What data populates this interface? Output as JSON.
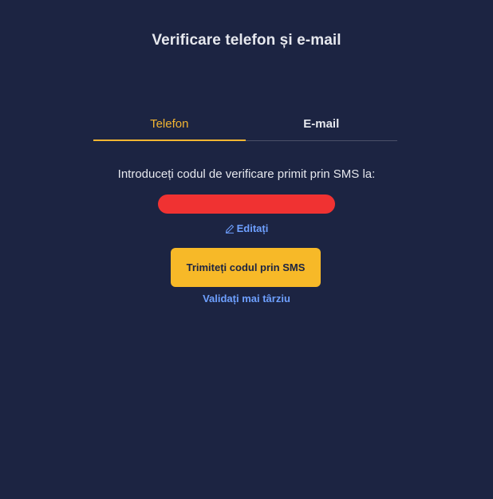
{
  "header": {
    "title": "Verificare telefon și e-mail"
  },
  "tabs": [
    {
      "label": "Telefon",
      "active": true
    },
    {
      "label": "E-mail",
      "active": false
    }
  ],
  "main": {
    "instruction": "Introduceți codul de verificare primit prin SMS la:",
    "phone_redacted_color": "#f03232",
    "edit_label": "Editați",
    "edit_icon": "pencil-icon",
    "send_button_label": "Trimiteți codul prin SMS",
    "later_link_label": "Validați mai târziu"
  },
  "colors": {
    "background": "#1c2442",
    "accent": "#f7b928",
    "link": "#6ea0ff",
    "text": "#e6e8ee"
  }
}
